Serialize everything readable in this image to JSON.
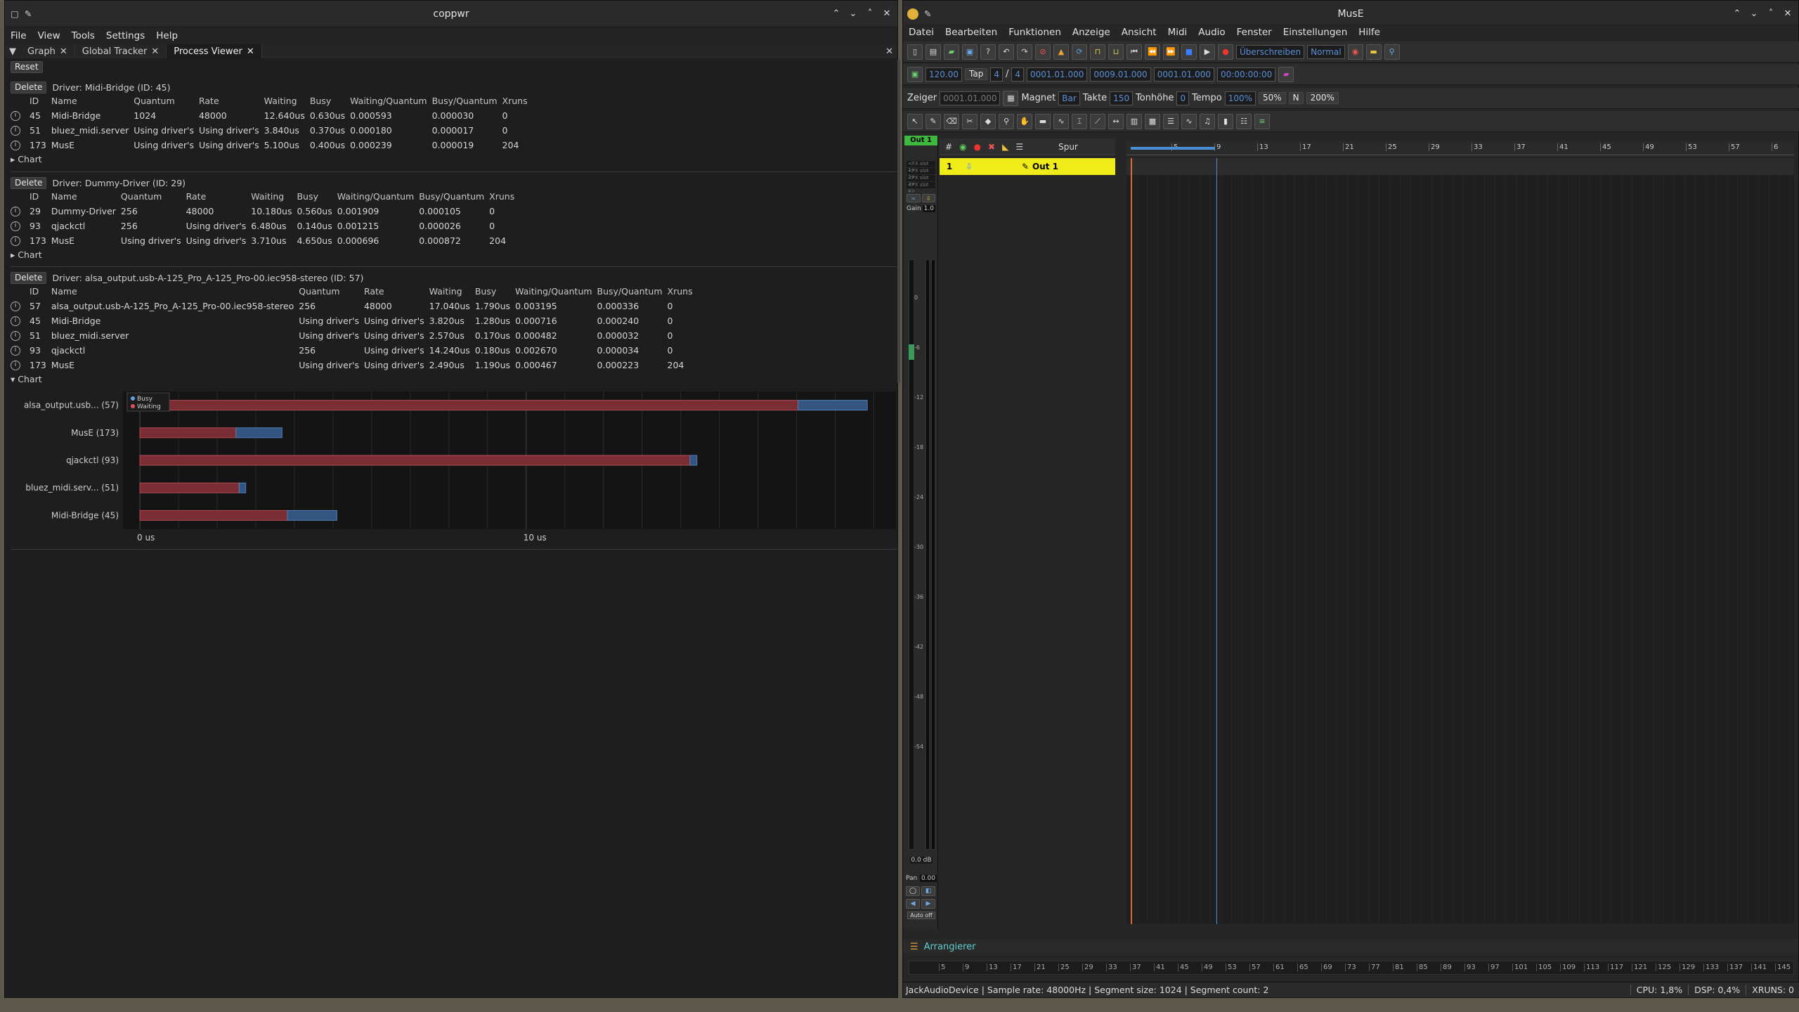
{
  "coppwr": {
    "title": "coppwr",
    "menu": [
      "File",
      "View",
      "Tools",
      "Settings",
      "Help"
    ],
    "tabs": [
      {
        "label": "Graph"
      },
      {
        "label": "Global Tracker"
      },
      {
        "label": "Process Viewer"
      }
    ],
    "reset_label": "Reset",
    "delete_label": "Delete",
    "chart_toggle_label": "Chart",
    "columns": [
      "ID",
      "Name",
      "Quantum",
      "Rate",
      "Waiting",
      "Busy",
      "Waiting/Quantum",
      "Busy/Quantum",
      "Xruns"
    ],
    "drivers": [
      {
        "header": "Driver: Midi-Bridge (ID: 45)",
        "rows": [
          [
            "45",
            "Midi-Bridge",
            "1024",
            "48000",
            "12.640us",
            "0.630us",
            "0.000593",
            "0.000030",
            "0"
          ],
          [
            "51",
            "bluez_midi.server",
            "Using driver's",
            "Using driver's",
            "3.840us",
            "0.370us",
            "0.000180",
            "0.000017",
            "0"
          ],
          [
            "173",
            "MusE",
            "Using driver's",
            "Using driver's",
            "5.100us",
            "0.400us",
            "0.000239",
            "0.000019",
            "204"
          ]
        ]
      },
      {
        "header": "Driver: Dummy-Driver (ID: 29)",
        "rows": [
          [
            "29",
            "Dummy-Driver",
            "256",
            "48000",
            "10.180us",
            "0.560us",
            "0.001909",
            "0.000105",
            "0"
          ],
          [
            "93",
            "qjackctl",
            "256",
            "Using driver's",
            "6.480us",
            "0.140us",
            "0.001215",
            "0.000026",
            "0"
          ],
          [
            "173",
            "MusE",
            "Using driver's",
            "Using driver's",
            "3.710us",
            "4.650us",
            "0.000696",
            "0.000872",
            "204"
          ]
        ]
      },
      {
        "header": "Driver: alsa_output.usb-A-125_Pro_A-125_Pro-00.iec958-stereo (ID: 57)",
        "rows": [
          [
            "57",
            "alsa_output.usb-A-125_Pro_A-125_Pro-00.iec958-stereo",
            "256",
            "48000",
            "17.040us",
            "1.790us",
            "0.003195",
            "0.000336",
            "0"
          ],
          [
            "45",
            "Midi-Bridge",
            "Using driver's",
            "Using driver's",
            "3.820us",
            "1.280us",
            "0.000716",
            "0.000240",
            "0"
          ],
          [
            "51",
            "bluez_midi.server",
            "Using driver's",
            "Using driver's",
            "2.570us",
            "0.170us",
            "0.000482",
            "0.000032",
            "0"
          ],
          [
            "93",
            "qjackctl",
            "256",
            "Using driver's",
            "14.240us",
            "0.180us",
            "0.002670",
            "0.000034",
            "0"
          ],
          [
            "173",
            "MusE",
            "Using driver's",
            "Using driver's",
            "2.490us",
            "1.190us",
            "0.000467",
            "0.000223",
            "204"
          ]
        ]
      }
    ]
  },
  "chart_data": {
    "type": "bar",
    "orientation": "horizontal",
    "stacked": true,
    "categories": [
      "alsa_output.usb... (57)",
      "MusE (173)",
      "qjackctl (93)",
      "bluez_midi.serv... (51)",
      "Midi-Bridge (45)"
    ],
    "series": [
      {
        "name": "Waiting",
        "color": "#7a2d33",
        "values": [
          17.04,
          2.49,
          14.24,
          2.57,
          3.82
        ]
      },
      {
        "name": "Busy",
        "color": "#33557f",
        "values": [
          1.79,
          1.19,
          0.18,
          0.17,
          1.28
        ]
      }
    ],
    "xticks": [
      "0 us",
      "10 us"
    ],
    "xlim": [
      0,
      19.5
    ],
    "legend": "top-left",
    "grid": true
  },
  "muse": {
    "title": "MusE",
    "menu": [
      "Datei",
      "Bearbeiten",
      "Funktionen",
      "Anzeige",
      "Ansicht",
      "Midi",
      "Audio",
      "Fenster",
      "Einstellungen",
      "Hilfe"
    ],
    "record_mode": "Überschreiben",
    "cycle_mode": "Normal",
    "tempo": "120.00",
    "tap_label": "Tap",
    "sig_num": "4",
    "sig_den": "4",
    "pos1": "0001.01.000",
    "pos2": "0009.01.000",
    "pos3": "0001.01.000",
    "time": "00:00:00:00",
    "zeiger_label": "Zeiger",
    "zeiger_value": "0001.01.000",
    "magnet_label": "Magnet",
    "magnet_value": "Bar",
    "takte_label": "Takte",
    "takte_value": "150",
    "tonhoehe_label": "Tonhöhe",
    "tonhoehe_value": "0",
    "tempo_label": "Tempo",
    "tempo_value": "100%",
    "zoom_50": "50%",
    "zoom_n": "N",
    "zoom_200": "200%",
    "strip_name": "Out 1",
    "fx_slots": [
      "<FX slot 1>",
      "<FX slot 2>",
      "<FX slot 3>",
      "<FX slot 4>"
    ],
    "gain_label": "Gain",
    "gain_value": "1.0",
    "meter_scale": [
      "0",
      "-6",
      "-12",
      "-18",
      "-24",
      "-30",
      "-36",
      "-42",
      "-48",
      "-54"
    ],
    "db_value": "0.0 dB",
    "pan_label": "Pan",
    "pan_value": "0.00",
    "auto_label": "Auto off",
    "track_header": {
      "num": "#",
      "name": "Spur"
    },
    "track": {
      "num": "1",
      "name": "Out 1"
    },
    "ruler": [
      "5",
      "9",
      "13",
      "17",
      "21",
      "25",
      "29",
      "33",
      "37",
      "41",
      "45",
      "49",
      "53",
      "57",
      "6"
    ],
    "bottom_ruler": [
      "5",
      "9",
      "13",
      "17",
      "21",
      "25",
      "29",
      "33",
      "37",
      "41",
      "45",
      "49",
      "53",
      "57",
      "61",
      "65",
      "69",
      "73",
      "77",
      "81",
      "85",
      "89",
      "93",
      "97",
      "101",
      "105",
      "109",
      "113",
      "117",
      "121",
      "125",
      "129",
      "133",
      "137",
      "141",
      "145"
    ],
    "arranger_tab": "Arrangierer",
    "status_left": "JackAudioDevice | Sample rate: 48000Hz | Segment size: 1024 | Segment count: 2",
    "cpu": "CPU: 1,8%",
    "dsp": "DSP: 0,4%",
    "xruns": "XRUNS: 0"
  }
}
